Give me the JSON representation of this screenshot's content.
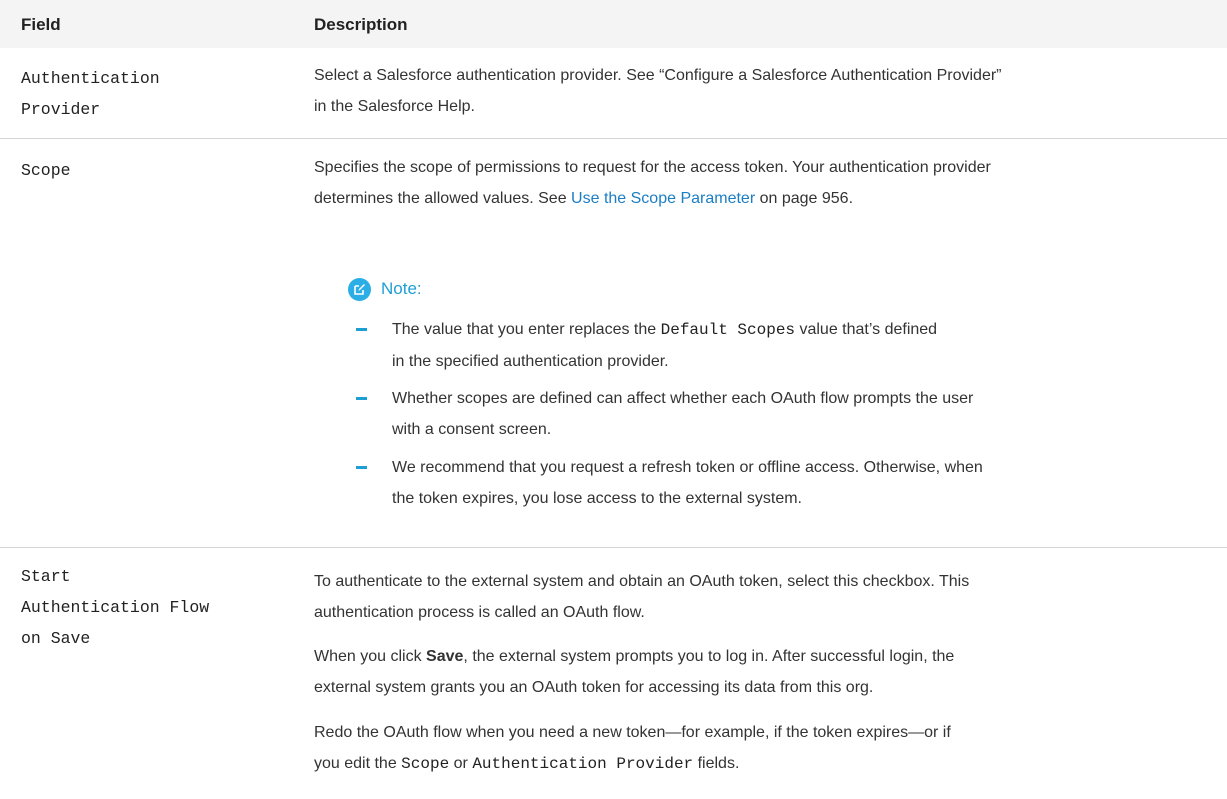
{
  "header": {
    "field": "Field",
    "description": "Description"
  },
  "rows": [
    {
      "field": [
        "Authentication",
        "Provider"
      ],
      "desc_pre": "Select a Salesforce authentication provider. See “Configure a Salesforce Authentication Provider”",
      "desc_post": "in the Salesforce Help."
    },
    {
      "field": [
        "Scope"
      ],
      "desc_line1": "Specifies the scope of permissions to request for the access token. Your authentication provider",
      "desc_line2_pre": "determines the allowed values. See ",
      "desc_link": "Use the Scope Parameter",
      "desc_line2_post": " on page 956.",
      "note": {
        "label": "Note:",
        "icon": "edit-note-icon",
        "bullets": [
          {
            "l1_pre": "The value that you enter replaces the ",
            "l1_code": "Default Scopes",
            "l1_post": " value that’s defined",
            "l2": "in the specified authentication provider."
          },
          {
            "l1": "Whether scopes are defined can affect whether each OAuth flow prompts the user",
            "l2": "with a consent screen."
          },
          {
            "l1": "We recommend that you request a refresh token or offline access. Otherwise, when",
            "l2": "the token expires, you lose access to the external system."
          }
        ]
      }
    },
    {
      "field": [
        "Start",
        "Authentication Flow",
        "on Save"
      ],
      "p1_l1": "To authenticate to the external system and obtain an OAuth token, select this checkbox. This",
      "p1_l2": "authentication process is called an OAuth flow.",
      "p2_pre": "When you click ",
      "p2_bold": "Save",
      "p2_post": ", the external system prompts you to log in. After successful login, the",
      "p2_l2": "external system grants you an OAuth token for accessing its data from this org.",
      "p3_l1": "Redo the OAuth flow when you need a new token—for example, if the token expires—or if",
      "p3_l2_pre": "you edit the ",
      "p3_code1": "Scope",
      "p3_mid": " or ",
      "p3_code2": "Authentication Provider",
      "p3_post": " fields."
    }
  ],
  "colors": {
    "accent": "#1e9fd4",
    "link": "#1b7ec4",
    "header_bg": "#f4f4f4"
  }
}
